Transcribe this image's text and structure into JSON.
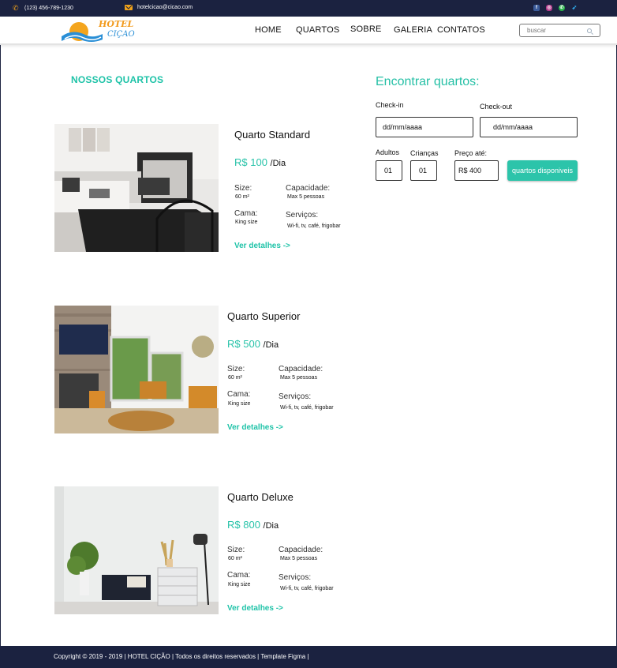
{
  "topbar": {
    "phone": "(123) 456-789-1230",
    "email": "hotelcicao@cicao.com",
    "social_icons": [
      "facebook-icon",
      "instagram-icon",
      "whatsapp-icon",
      "twitter-icon"
    ]
  },
  "logo": {
    "line1": "HOTEL",
    "line2": "CIÇAO"
  },
  "nav": [
    "HOME",
    "QUARTOS",
    "SOBRE",
    "GALERIA",
    "CONTATOS"
  ],
  "search": {
    "placeholder": "buscar"
  },
  "section_title": "NOSSOS QUARTOS",
  "rooms": [
    {
      "name": "Quarto Standard",
      "price": "R$ 100",
      "per": "/Dia",
      "size_label": "Size:",
      "size": "60 m²",
      "capacity_label": "Capacidade:",
      "capacity": "Max 5 pessoas",
      "bed_label": "Cama:",
      "bed": "King size",
      "services_label": "Serviços:",
      "services": "Wi-fi, tv, café, frigobar",
      "details": "Ver detalhes ->"
    },
    {
      "name": "Quarto Superior",
      "price": "R$ 500",
      "per": "/Dia",
      "size_label": "Size:",
      "size": "60 m²",
      "capacity_label": "Capacidade:",
      "capacity": "Max 5 pessoas",
      "bed_label": "Cama:",
      "bed": "King size",
      "services_label": "Serviços:",
      "services": "Wi-fi, tv, café, frigobar",
      "details": "Ver detalhes ->"
    },
    {
      "name": "Quarto Deluxe",
      "price": "R$ 800",
      "per": "/Dia",
      "size_label": "Size:",
      "size": "60 m²",
      "capacity_label": "Capacidade:",
      "capacity": "Max 5 pessoas",
      "bed_label": "Cama:",
      "bed": "King size",
      "services_label": "Serviços:",
      "services": "Wi-fi, tv, café, frigobar",
      "details": "Ver detalhes ->"
    }
  ],
  "finder": {
    "title": "Encontrar quartos:",
    "checkin_label": "Check-in",
    "checkin_value": "dd/mm/aaaa",
    "checkout_label": "Check-out",
    "checkout_value": "dd/mm/aaaa",
    "adults_label": "Adultos",
    "adults_value": "01",
    "children_label": "Crianças",
    "children_value": "01",
    "price_label": "Preço até:",
    "price_value": "R$ 400",
    "button": "quartos disponiveis"
  },
  "footer": "Copyright © 2019 - 2019 | HOTEL CIÇÃO | Todos os direitos reservados | Template Figma |",
  "colors": {
    "accent": "#2cc4aa",
    "dark": "#1b2240",
    "logo_orange": "#f29a1c",
    "logo_blue": "#2b8fd6"
  }
}
